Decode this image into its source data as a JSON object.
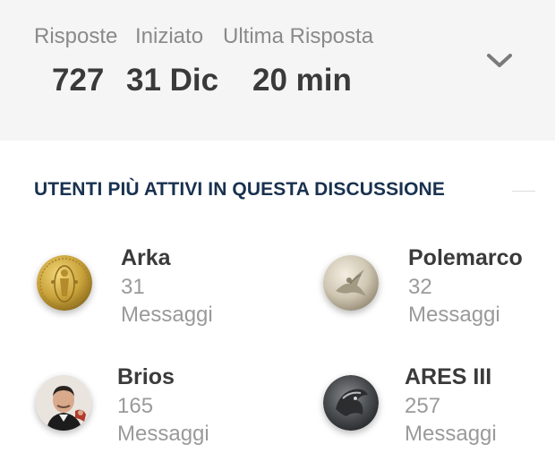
{
  "stats": {
    "replies_label": "Risposte",
    "replies_value": "727",
    "started_label": "Iniziato",
    "started_value": "31 Dic",
    "last_reply_label": "Ultima Risposta",
    "last_reply_value": "20 min",
    "expand_icon": "chevron-down-icon"
  },
  "section": {
    "title": "UTENTI PIÙ ATTIVI IN QUESTA DISCUSSIONE"
  },
  "users": [
    {
      "name": "Arka",
      "count": "31",
      "label": "Messaggi",
      "avatar": "gold-coin-avatar"
    },
    {
      "name": "Polemarco",
      "count": "32",
      "label": "Messaggi",
      "avatar": "silver-coin-avatar"
    },
    {
      "name": "Brios",
      "count": "165",
      "label": "Messaggi",
      "avatar": "photo-avatar"
    },
    {
      "name": "ARES III",
      "count": "257",
      "label": "Messaggi",
      "avatar": "dark-coin-avatar"
    }
  ],
  "colors": {
    "stats_background": "#f5f5f5",
    "title": "#19314f",
    "name": "#3a3a3a",
    "muted": "#9a9a9a"
  }
}
